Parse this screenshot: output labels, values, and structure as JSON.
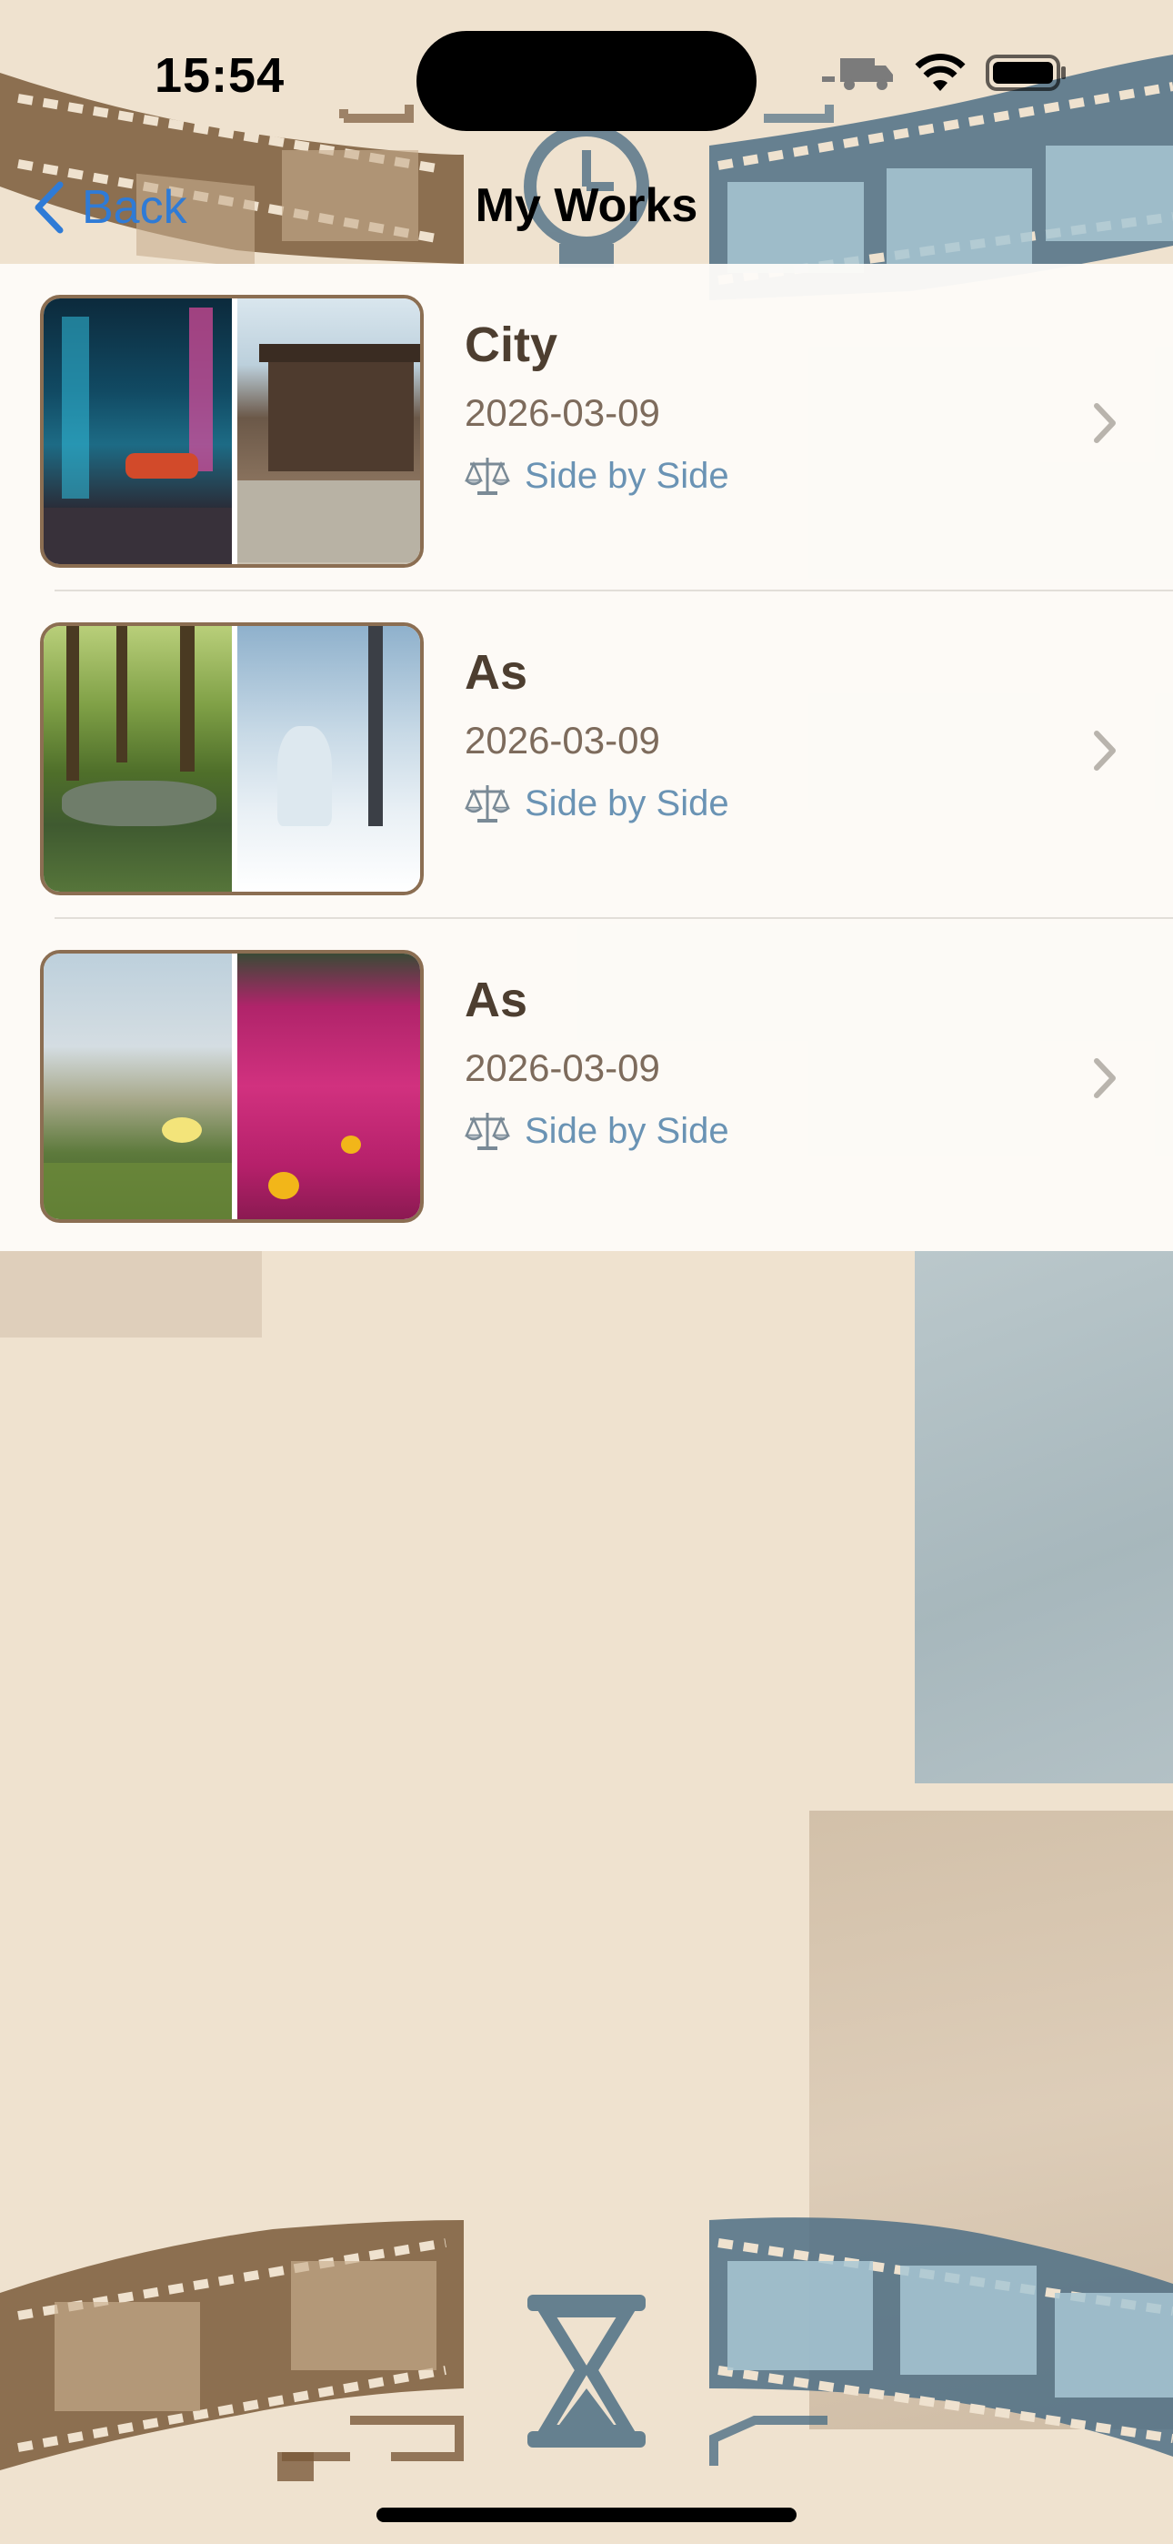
{
  "status_bar": {
    "time": "15:54"
  },
  "nav": {
    "back_label": "Back",
    "title": "My Works"
  },
  "works": [
    {
      "title": "City",
      "date": "2026-03-09",
      "mode": "Side by Side",
      "left_image": "cyberpunk city street at night",
      "right_image": "traditional japanese house street"
    },
    {
      "title": "As",
      "date": "2026-03-09",
      "mode": "Side by Side",
      "left_image": "green forest with stream",
      "right_image": "snowy winter forest"
    },
    {
      "title": "As",
      "date": "2026-03-09",
      "mode": "Side by Side",
      "left_image": "yellow flower in grass",
      "right_image": "magenta flower field"
    }
  ],
  "icons": {
    "back": "chevron-left-icon",
    "mode": "scales-icon",
    "row_disclosure": "chevron-right-icon",
    "bottom_center": "hourglass-icon",
    "top_center": "stopwatch-icon"
  },
  "colors": {
    "background": "#efe2cf",
    "accent_blue": "#2f7bd6",
    "mode_blue": "#6a93b4",
    "film_brown": "#7a5a3a",
    "film_blue": "#4e6f85"
  }
}
